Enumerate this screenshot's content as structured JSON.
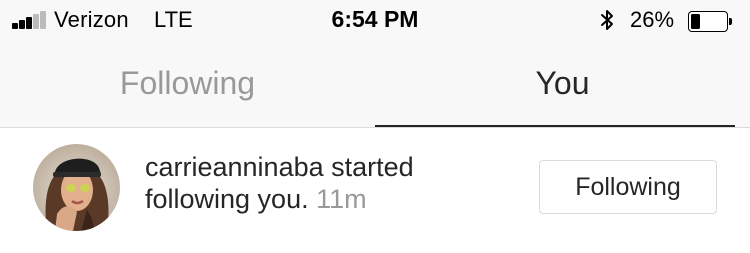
{
  "status_bar": {
    "carrier": "Verizon",
    "network": "LTE",
    "time": "6:54 PM",
    "battery_percent": "26%",
    "battery_level": 0.26,
    "signal_bars_filled": 3,
    "signal_bars_total": 5,
    "bluetooth_icon": "bluetooth-icon"
  },
  "tabs": [
    {
      "label": "Following",
      "active": false
    },
    {
      "label": "You",
      "active": true
    }
  ],
  "notification": {
    "username": "carrieanninaba",
    "action_text": " started following you.",
    "time_ago": "11m",
    "avatar_icon": "user-avatar",
    "button_label": "Following"
  },
  "colors": {
    "active_text": "#262626",
    "inactive_text": "#999999",
    "border": "#dbdbdb",
    "header_bg": "#f8f8f8"
  }
}
